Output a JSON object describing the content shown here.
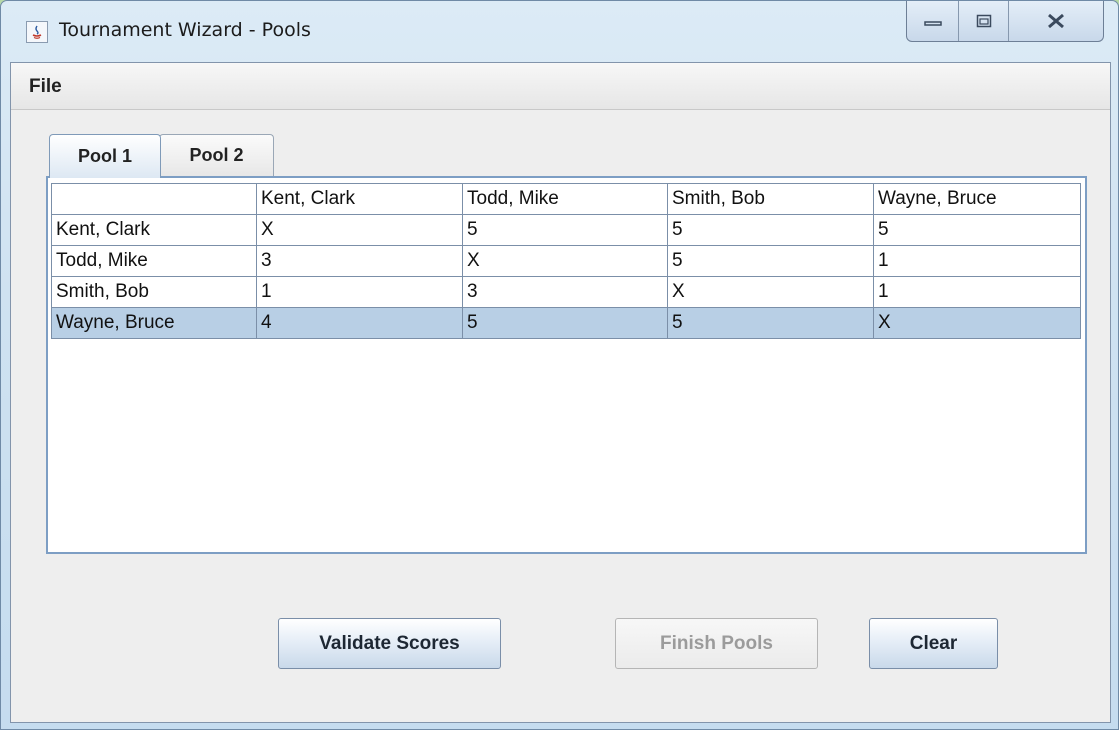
{
  "window": {
    "title": "Tournament Wizard - Pools"
  },
  "menu": {
    "file": "File"
  },
  "tabs": [
    {
      "label": "Pool 1",
      "active": true
    },
    {
      "label": "Pool 2",
      "active": false
    }
  ],
  "table": {
    "headers": [
      "",
      "Kent, Clark",
      "Todd, Mike",
      "Smith, Bob",
      "Wayne, Bruce"
    ],
    "rows": [
      [
        "Kent, Clark",
        "X",
        "5",
        "5",
        "5"
      ],
      [
        "Todd, Mike",
        "3",
        "X",
        "5",
        "1"
      ],
      [
        "Smith, Bob",
        "1",
        "3",
        "X",
        "1"
      ],
      [
        "Wayne, Bruce",
        "4",
        "5",
        "5",
        "X"
      ]
    ],
    "selected_row": 3
  },
  "buttons": {
    "validate": "Validate Scores",
    "finish": "Finish Pools",
    "clear": "Clear"
  },
  "icons": {
    "app": "java-app-icon",
    "minimize": "minimize-icon",
    "maximize": "maximize-icon",
    "close": "close-icon"
  },
  "colors": {
    "selection": "#b8cfe5",
    "panel_border": "#7d9ec4"
  }
}
